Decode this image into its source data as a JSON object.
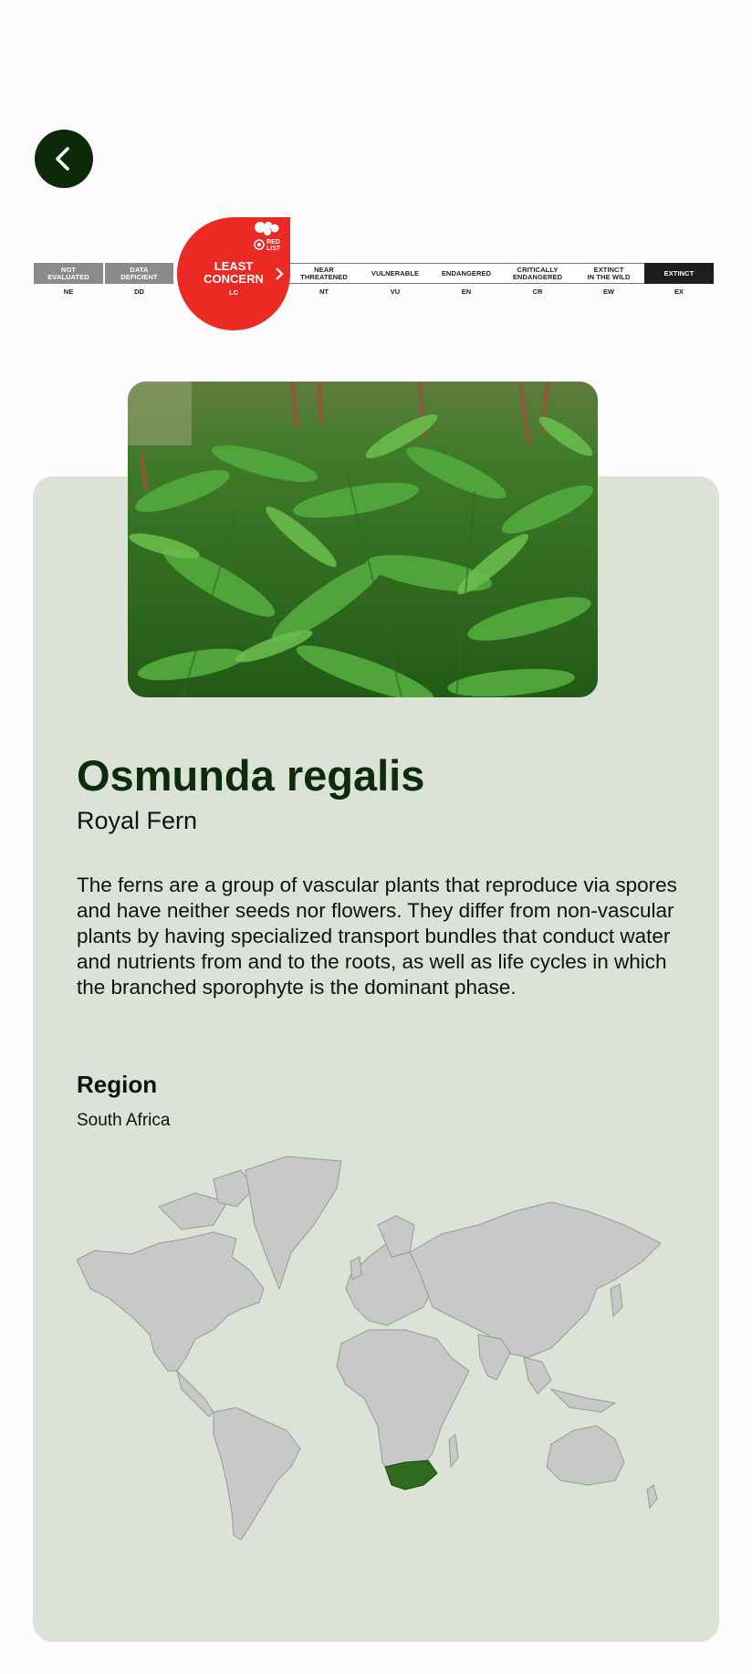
{
  "nav": {
    "back_icon": "chevron-left-icon"
  },
  "red_list": {
    "categories": [
      {
        "label": "NOT\nEVALUATED",
        "abbr": "NE"
      },
      {
        "label": "DATA\nDEFICIENT",
        "abbr": "DD"
      },
      {
        "label": "LEAST\nCONCERN",
        "abbr": "LC"
      },
      {
        "label": "NEAR\nTHREATENED",
        "abbr": "NT"
      },
      {
        "label": "VULNERABLE",
        "abbr": "VU"
      },
      {
        "label": "ENDANGERED",
        "abbr": "EN"
      },
      {
        "label": "CRITICALLY\nENDANGERED",
        "abbr": "CR"
      },
      {
        "label": "EXTINCT\nIN THE WILD",
        "abbr": "EW"
      },
      {
        "label": "EXTINCT",
        "abbr": "EX"
      }
    ],
    "current": "LC",
    "logo_text": "RED LIST",
    "accent": "#ea2a23"
  },
  "species": {
    "scientific_name": "Osmunda regalis",
    "common_name": "Royal Fern",
    "description": "The ferns are a group of vascular plants that reproduce via spores and have neither seeds nor flowers. They differ from non-vascular plants by having specialized transport bundles that conduct water and nutrients from and to the roots, as well as life cycles in which the branched sporophyte is the dominant phase."
  },
  "region": {
    "heading": "Region",
    "value": "South Africa",
    "highlight_color": "#2f6b1e"
  }
}
